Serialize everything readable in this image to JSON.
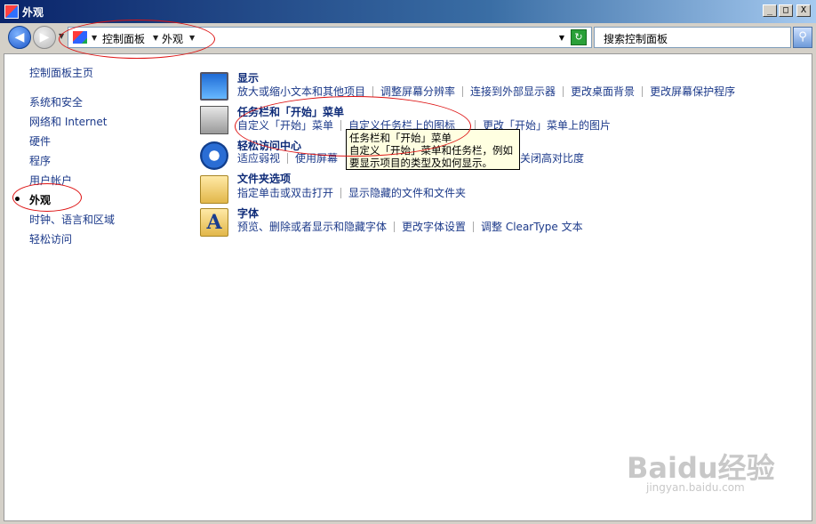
{
  "window": {
    "title": "外观",
    "buttons": {
      "minimize": "_",
      "maximize": "□",
      "close": "X"
    }
  },
  "toolbar": {
    "back_glyph": "◀",
    "forward_glyph": "▶",
    "breadcrumbs": [
      "控制面板",
      "外观"
    ],
    "refresh_glyph": "↻",
    "search_placeholder": "搜索控制面板",
    "search_glyph": "⚲"
  },
  "sidebar": {
    "items": [
      {
        "label": "控制面板主页"
      },
      {
        "label": "系统和安全"
      },
      {
        "label": "网络和 Internet"
      },
      {
        "label": "硬件"
      },
      {
        "label": "程序"
      },
      {
        "label": "用户帐户"
      },
      {
        "label": "外观",
        "current": true
      },
      {
        "label": "时钟、语言和区域"
      },
      {
        "label": "轻松访问"
      }
    ]
  },
  "categories": [
    {
      "title": "显示",
      "icon": "monitor-icon",
      "links": [
        "放大或缩小文本和其他项目",
        "调整屏幕分辨率",
        "连接到外部显示器",
        "更改桌面背景",
        "更改屏幕保护程序"
      ]
    },
    {
      "title": "任务栏和「开始」菜单",
      "icon": "taskbar-icon",
      "links": [
        "自定义「开始」菜单",
        "自定义任务栏上的图标",
        "更改「开始」菜单上的图片"
      ]
    },
    {
      "title": "轻松访问中心",
      "icon": "ease-of-access-icon",
      "links": [
        "适应弱视",
        "使用屏幕",
        "关闭高对比度"
      ]
    },
    {
      "title": "文件夹选项",
      "icon": "folder-options-icon",
      "links": [
        "指定单击或双击打开",
        "显示隐藏的文件和文件夹"
      ]
    },
    {
      "title": "字体",
      "icon": "fonts-icon",
      "links": [
        "预览、删除或者显示和隐藏字体",
        "更改字体设置",
        "调整 ClearType 文本"
      ]
    }
  ],
  "tooltip": {
    "lines": [
      "任务栏和「开始」菜单",
      "自定义「开始」菜单和任务栏，例如",
      "要显示项目的类型及如何显示。"
    ]
  },
  "font_icon_glyph": "A",
  "watermark": {
    "brand": "Baidu经验",
    "url": "jingyan.baidu.com"
  },
  "colors": {
    "link": "#1c3a8a",
    "title_link": "#0e2b78",
    "annotation": "#dd1111"
  }
}
